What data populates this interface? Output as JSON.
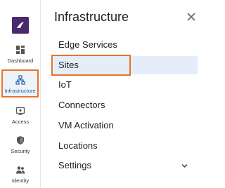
{
  "rail": {
    "items": [
      {
        "label": "Dashboard",
        "icon": "dashboard-icon"
      },
      {
        "label": "Infrastructure",
        "icon": "network-icon"
      },
      {
        "label": "Access",
        "icon": "access-icon"
      },
      {
        "label": "Security",
        "icon": "shield-icon"
      },
      {
        "label": "Identity",
        "icon": "users-icon"
      }
    ],
    "active_index": 1
  },
  "panel": {
    "title": "Infrastructure",
    "items": [
      {
        "label": "Edge Services"
      },
      {
        "label": "Sites"
      },
      {
        "label": "IoT"
      },
      {
        "label": "Connectors"
      },
      {
        "label": "VM Activation"
      },
      {
        "label": "Locations"
      },
      {
        "label": "Settings"
      }
    ],
    "selected_index": 1
  },
  "colors": {
    "brand": "#4b2a6b",
    "highlight_outline": "#e8732a",
    "selected_bg": "#e5eef8",
    "active_label": "#1f5fa8"
  }
}
